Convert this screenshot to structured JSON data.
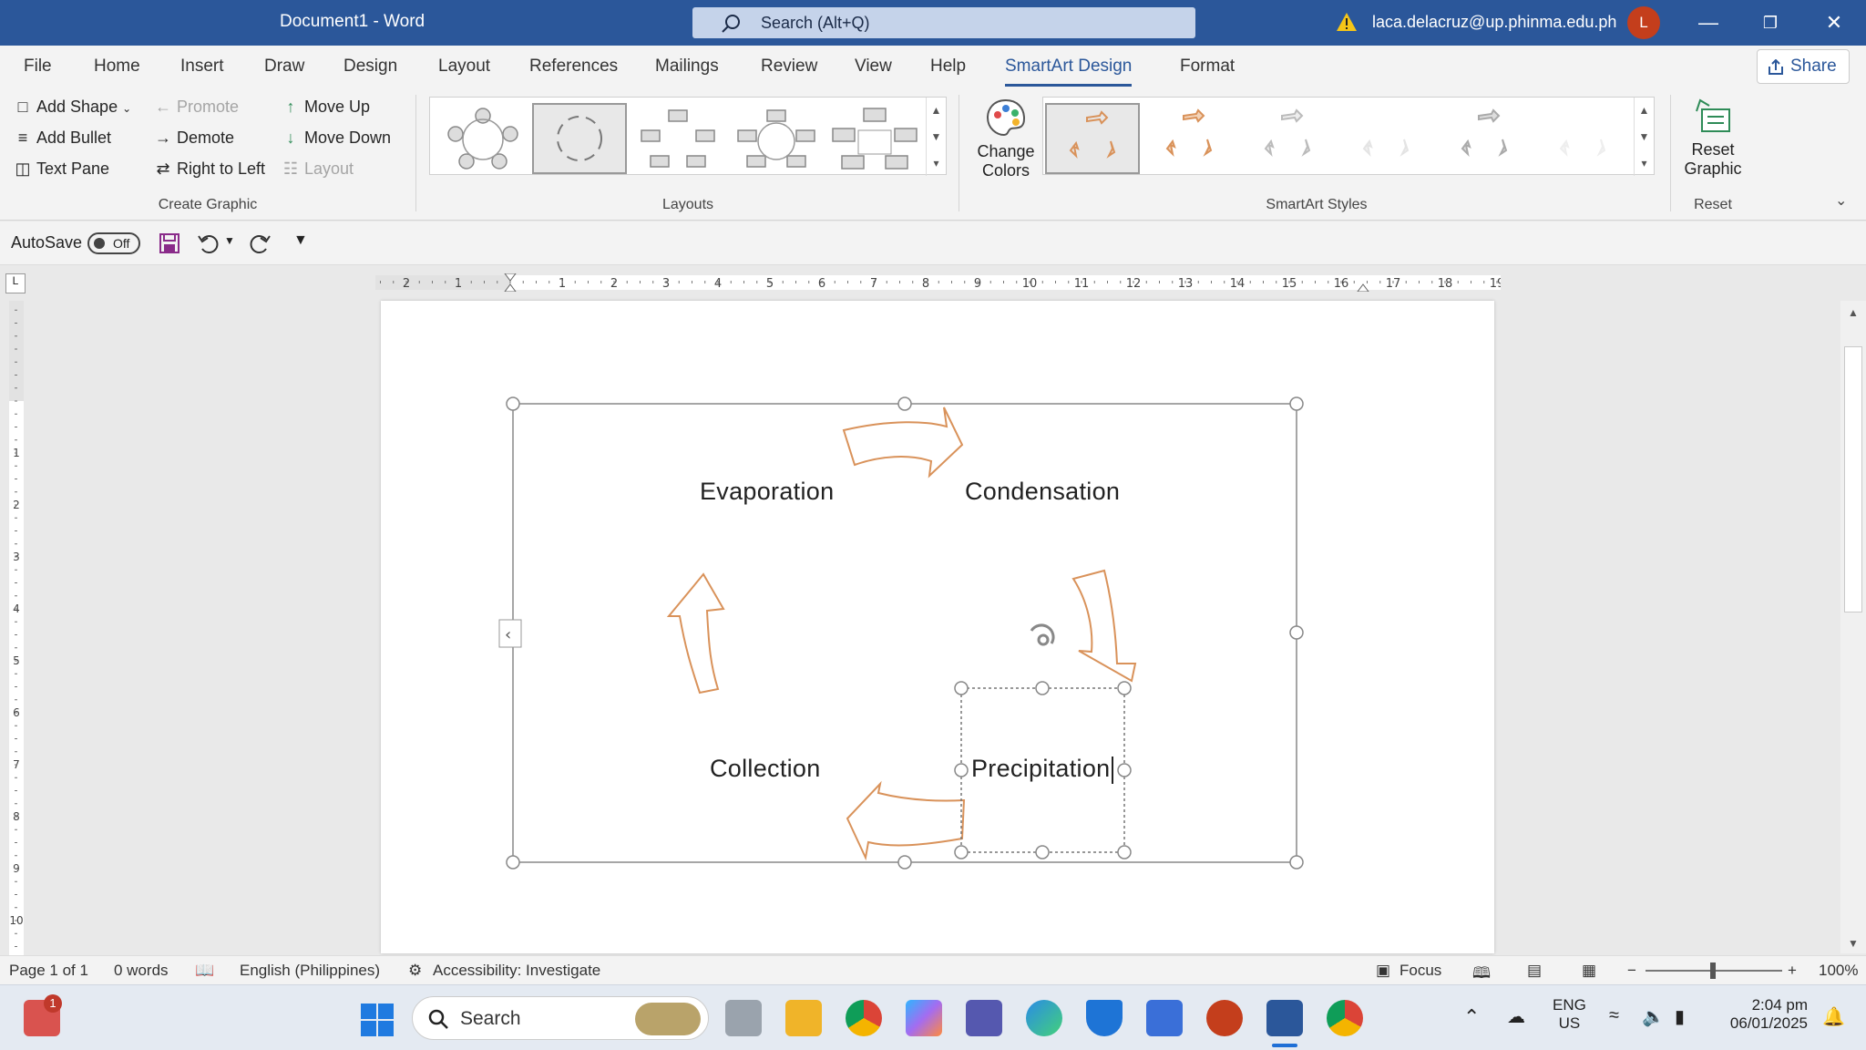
{
  "window": {
    "title": "Document1  -  Word",
    "search_placeholder": "Search (Alt+Q)",
    "user_email": "laca.delacruz@up.phinma.edu.ph",
    "avatar_initial": "L"
  },
  "ribbon_tabs": [
    "File",
    "Home",
    "Insert",
    "Draw",
    "Design",
    "Layout",
    "References",
    "Mailings",
    "Review",
    "View",
    "Help",
    "SmartArt Design",
    "Format"
  ],
  "active_tab": "SmartArt Design",
  "share_label": "Share",
  "create_graphic": {
    "add_shape": "Add Shape",
    "add_bullet": "Add Bullet",
    "text_pane": "Text Pane",
    "promote": "Promote",
    "demote": "Demote",
    "right_to_left": "Right to Left",
    "move_up": "Move Up",
    "move_down": "Move Down",
    "layout": "Layout",
    "group_label": "Create Graphic"
  },
  "layouts_group_label": "Layouts",
  "change_colors": {
    "line1": "Change",
    "line2": "Colors"
  },
  "styles_group_label": "SmartArt Styles",
  "reset": {
    "line1": "Reset",
    "line2": "Graphic",
    "group_label": "Reset"
  },
  "qat": {
    "autosave": "AutoSave",
    "toggle": "Off"
  },
  "ruler_numbers": [
    "2",
    "1",
    "1",
    "2",
    "3",
    "4",
    "5",
    "6",
    "7",
    "8",
    "9",
    "10",
    "11",
    "12",
    "13",
    "14",
    "15",
    "16",
    "17",
    "18",
    "19"
  ],
  "smartart": {
    "nodes": [
      "Evaporation",
      "Condensation",
      "Precipitation",
      "Collection"
    ],
    "arrow_color": "#d9925a"
  },
  "status": {
    "page": "Page 1 of 1",
    "words": "0 words",
    "language": "English (Philippines)",
    "accessibility": "Accessibility: Investigate",
    "focus": "Focus",
    "zoom": "100%"
  },
  "taskbar": {
    "search": "Search",
    "lang1": "ENG",
    "lang2": "US",
    "time": "2:04 pm",
    "date": "06/01/2025",
    "badge": "1"
  }
}
